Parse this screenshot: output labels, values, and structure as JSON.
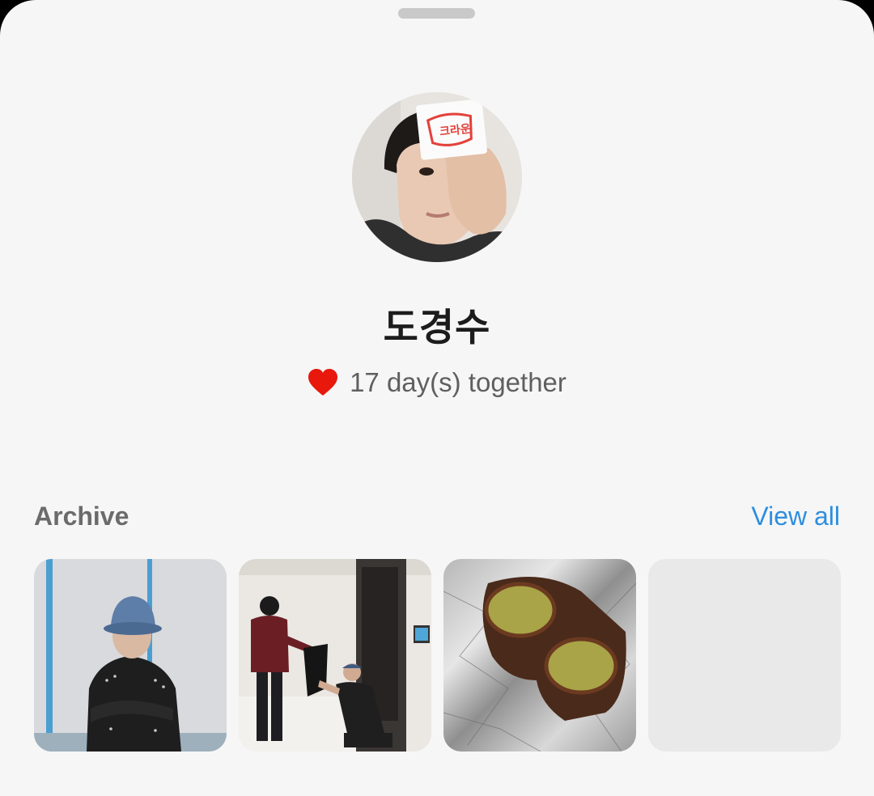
{
  "profile": {
    "name": "도경수",
    "days_together": "17 day(s) together",
    "avatar_icon": "profile-photo",
    "heart_color": "#e8180c"
  },
  "archive": {
    "title": "Archive",
    "view_all_label": "View all",
    "items": [
      {
        "image": "photo-man-in-cap"
      },
      {
        "image": "photo-hallway-two-men"
      },
      {
        "image": "photo-chocolate-dessert"
      },
      {
        "image": "empty-placeholder"
      }
    ]
  },
  "colors": {
    "background": "#f6f6f6",
    "accent": "#2d8ee0"
  }
}
